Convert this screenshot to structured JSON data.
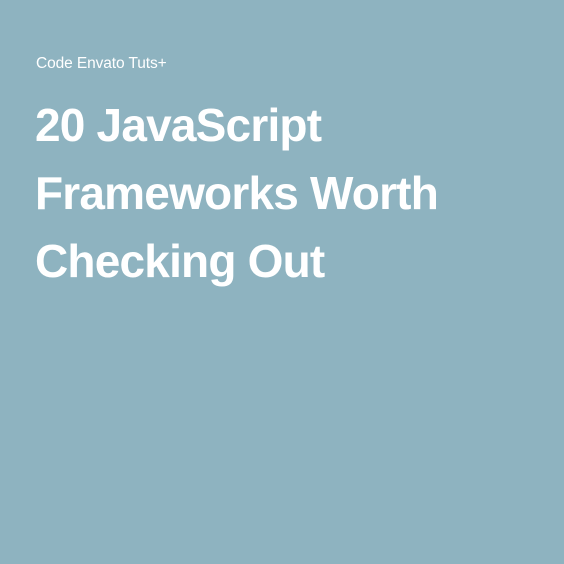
{
  "card": {
    "background_color": "#8eb3c0",
    "text_color": "#ffffff",
    "source": "Code Envato Tuts+",
    "title_lines": [
      "20 JavaScript",
      "Frameworks Worth",
      "Checking Out"
    ]
  }
}
